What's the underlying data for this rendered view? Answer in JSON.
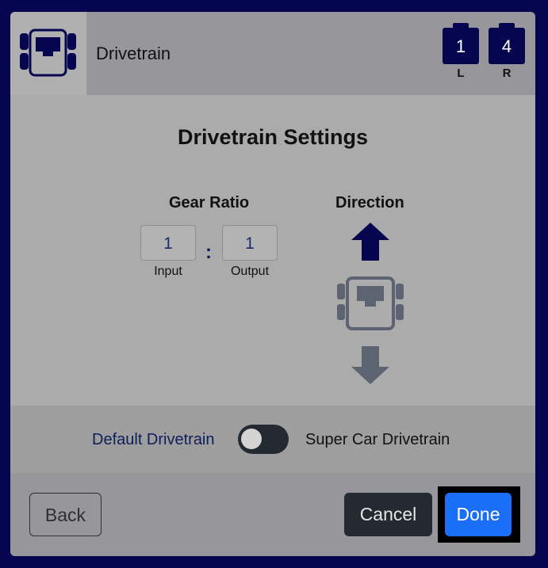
{
  "header": {
    "title": "Drivetrain",
    "ports": [
      {
        "number": "1",
        "side": "L"
      },
      {
        "number": "4",
        "side": "R"
      }
    ]
  },
  "settings": {
    "title": "Drivetrain Settings",
    "gear_ratio": {
      "label": "Gear Ratio",
      "input_value": "1",
      "input_label": "Input",
      "separator": ":",
      "output_value": "1",
      "output_label": "Output"
    },
    "direction": {
      "label": "Direction",
      "selected": "forward"
    }
  },
  "mode_toggle": {
    "left_label": "Default Drivetrain",
    "right_label": "Super Car Drivetrain",
    "state": "off"
  },
  "footer": {
    "back_label": "Back",
    "cancel_label": "Cancel",
    "done_label": "Done"
  },
  "colors": {
    "background": "#05064f",
    "accent": "#1a6ef7",
    "dark_button": "#242a31",
    "icon_active": "#05064f",
    "icon_inactive": "#5b6470"
  }
}
